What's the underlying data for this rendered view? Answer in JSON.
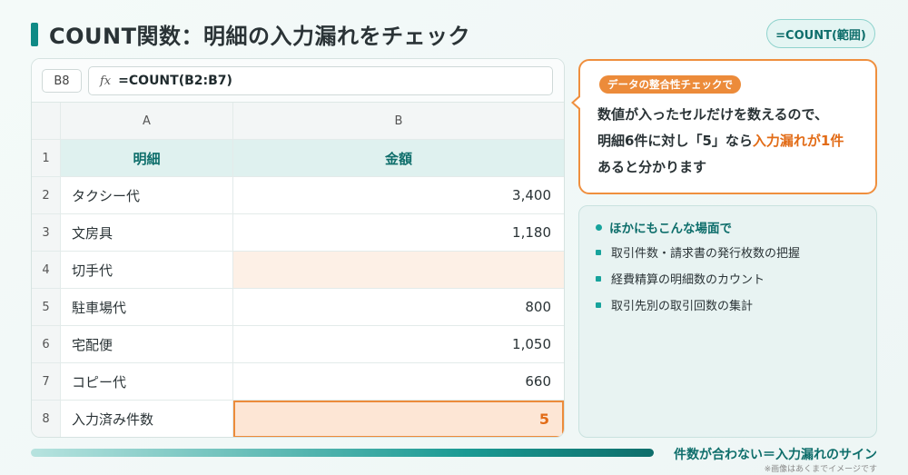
{
  "title": "COUNT関数：明細の入力漏れをチェック",
  "formula_pill": "=COUNT(範囲)",
  "sheet": {
    "name_box": "B8",
    "fx_label": "fx",
    "formula": "=COUNT(B2:B7)",
    "columns": [
      "A",
      "B"
    ],
    "header": {
      "row": "1",
      "a": "明細",
      "b": "金額"
    },
    "rows": [
      {
        "row": "2",
        "a": "タクシー代",
        "b": "3,400"
      },
      {
        "row": "3",
        "a": "文房具",
        "b": "1,180"
      },
      {
        "row": "4",
        "a": "切手代",
        "b": ""
      },
      {
        "row": "5",
        "a": "駐車場代",
        "b": "800"
      },
      {
        "row": "6",
        "a": "宅配便",
        "b": "1,050"
      },
      {
        "row": "7",
        "a": "コピー代",
        "b": "660"
      }
    ],
    "total": {
      "row": "8",
      "a": "入力済み件数",
      "b": "5"
    }
  },
  "callout": {
    "badge": "データの整合性チェックで",
    "line1": "数値が入ったセルだけを数えるので、",
    "line2_pre": "明細6件に対し「5」なら",
    "line2_hl": "入力漏れが1件",
    "line3": "あると分かります"
  },
  "tips": {
    "heading": "ほかにもこんな場面で",
    "items": [
      "取引件数・請求書の発行枚数の把握",
      "経費精算の明細数のカウント",
      "取引先別の取引回数の集計"
    ]
  },
  "footer": {
    "message": "件数が合わない＝入力漏れのサイン",
    "note": "※画像はあくまでイメージです"
  },
  "colors": {
    "accent_teal": "#0f8a86",
    "accent_orange": "#ec8b3a"
  }
}
